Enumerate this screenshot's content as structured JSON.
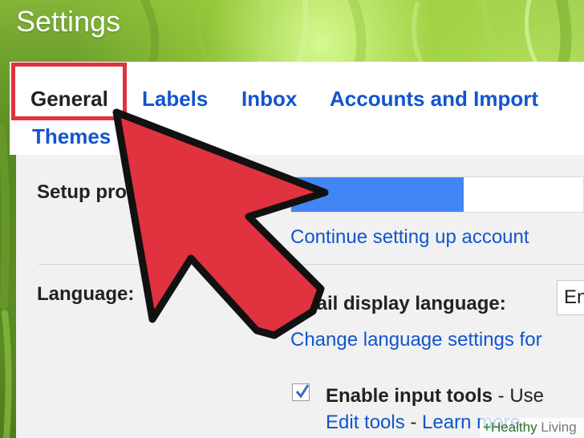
{
  "window": {
    "title": "Settings"
  },
  "tabs": [
    {
      "label": "General",
      "active": true
    },
    {
      "label": "Labels",
      "active": false
    },
    {
      "label": "Inbox",
      "active": false
    },
    {
      "label": "Accounts and Import",
      "active": false
    },
    {
      "label": "Themes",
      "active": false
    }
  ],
  "setup_progress": {
    "label": "Setup prog",
    "progress_fraction": 0.59,
    "link": "Continue setting up account"
  },
  "language": {
    "label": "Language:",
    "display_label": "nail display language:",
    "select_value": "En",
    "change_link": "Change language settings for"
  },
  "input_tools": {
    "checked": true,
    "label_bold": "Enable input tools",
    "label_rest": " - Use",
    "edit_link": "Edit tools",
    "separator": " - ",
    "learn_link": "Learn more"
  },
  "watermark": {
    "brand_a": "Healthy",
    "brand_b": " Living",
    "plus_icon": "+"
  },
  "colors": {
    "link": "#1155cc",
    "highlight": "#e0323f",
    "arrow": "#e0323f",
    "progress": "#4285f4"
  }
}
